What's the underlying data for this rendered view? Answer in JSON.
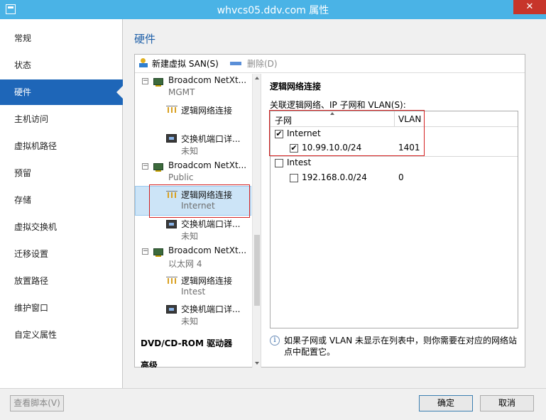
{
  "window": {
    "title": "whvcs05.ddv.com 属性"
  },
  "nav": {
    "items": [
      "常规",
      "状态",
      "硬件",
      "主机访问",
      "虚拟机路径",
      "预留",
      "存储",
      "虚拟交换机",
      "迁移设置",
      "放置路径",
      "维护窗口",
      "自定义属性"
    ],
    "active_index": 2
  },
  "page": {
    "title": "硬件",
    "toolbar": {
      "new_san": "新建虚拟 SAN(S)",
      "delete": "删除(D)"
    }
  },
  "tree": {
    "adapters": [
      {
        "name": "Broadcom NetXt...",
        "sub": "MGMT",
        "logical": {
          "label": "逻辑网络连接",
          "sub": ""
        },
        "switch": {
          "label": "交换机端口详...",
          "sub": "未知"
        }
      },
      {
        "name": "Broadcom NetXt...",
        "sub": "Public",
        "logical": {
          "label": "逻辑网络连接",
          "sub": "Internet"
        },
        "switch": {
          "label": "交换机端口详...",
          "sub": "未知"
        }
      },
      {
        "name": "Broadcom NetXt...",
        "sub": "以太网 4",
        "logical": {
          "label": "逻辑网络连接",
          "sub": "Intest"
        },
        "switch": {
          "label": "交换机端口详...",
          "sub": "未知"
        }
      }
    ],
    "groups": [
      "DVD/CD-ROM 驱动器",
      "高级"
    ]
  },
  "detail": {
    "title": "逻辑网络连接",
    "subtitle": "关联逻辑网络、IP 子网和 VLAN(S):",
    "columns": {
      "subnet": "子网",
      "vlan": "VLAN"
    },
    "networks": [
      {
        "name": "Internet",
        "checked": true,
        "subnets": [
          {
            "subnet": "10.99.10.0/24",
            "vlan": "1401",
            "checked": true
          }
        ]
      },
      {
        "name": "Intest",
        "checked": false,
        "subnets": [
          {
            "subnet": "192.168.0.0/24",
            "vlan": "0",
            "checked": false
          }
        ]
      }
    ],
    "info": "如果子网或 VLAN 未显示在列表中，则你需要在对应的网络站点中配置它。"
  },
  "footer": {
    "script": "查看脚本(V)",
    "ok": "确定",
    "cancel": "取消"
  }
}
